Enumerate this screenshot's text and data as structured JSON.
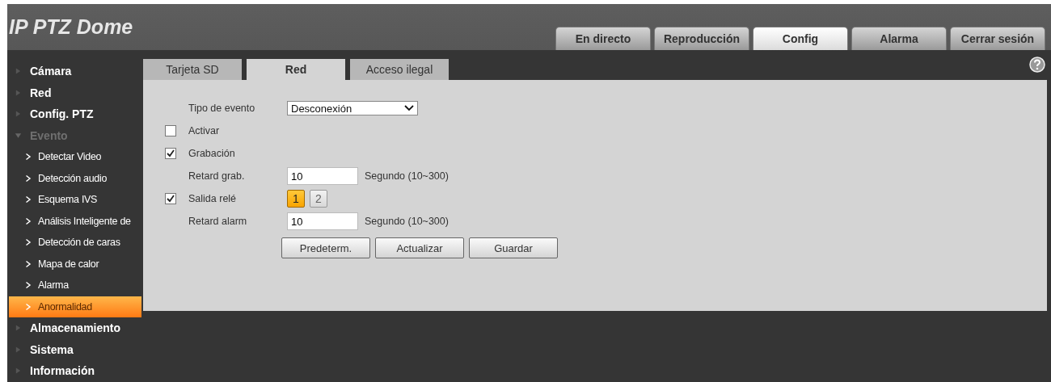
{
  "header": {
    "title": "IP PTZ Dome"
  },
  "nav_tabs": [
    {
      "label": "En directo",
      "selected": false
    },
    {
      "label": "Reproducción",
      "selected": false
    },
    {
      "label": "Config",
      "selected": true
    },
    {
      "label": "Alarma",
      "selected": false
    },
    {
      "label": "Cerrar sesión",
      "selected": false
    }
  ],
  "sidebar": {
    "items": [
      {
        "label": "Cámara",
        "expanded": false
      },
      {
        "label": "Red",
        "expanded": false
      },
      {
        "label": "Config. PTZ",
        "expanded": false
      },
      {
        "label": "Evento",
        "expanded": true,
        "children": [
          {
            "label": "Detectar Video",
            "selected": false
          },
          {
            "label": "Detección audio",
            "selected": false
          },
          {
            "label": "Esquema IVS",
            "selected": false
          },
          {
            "label": "Análisis Inteligente de",
            "selected": false
          },
          {
            "label": "Detección de caras",
            "selected": false
          },
          {
            "label": "Mapa de calor",
            "selected": false
          },
          {
            "label": "Alarma",
            "selected": false
          },
          {
            "label": "Anormalidad",
            "selected": true
          }
        ]
      },
      {
        "label": "Almacenamiento",
        "expanded": false
      },
      {
        "label": "Sistema",
        "expanded": false
      },
      {
        "label": "Información",
        "expanded": false
      }
    ]
  },
  "sub_tabs": [
    {
      "label": "Tarjeta SD",
      "selected": false
    },
    {
      "label": "Red",
      "selected": true
    },
    {
      "label": "Acceso ilegal",
      "selected": false
    }
  ],
  "form": [
    {
      "kind": "select",
      "label": "Tipo de evento",
      "value": "Desconexión"
    },
    {
      "kind": "checkbox",
      "label": "Activar",
      "checked": false
    },
    {
      "kind": "checkbox",
      "label": "Grabación",
      "checked": true
    },
    {
      "kind": "number",
      "label": "Retard grab.",
      "value": "10",
      "hint": "Segundo (10~300)"
    },
    {
      "kind": "relay",
      "label": "Salida relé",
      "checked": true,
      "options": [
        {
          "label": "1",
          "selected": true
        },
        {
          "label": "2",
          "selected": false
        }
      ]
    },
    {
      "kind": "number",
      "label": "Retard alarm",
      "value": "10",
      "hint": "Segundo (10~300)"
    }
  ],
  "buttons": [
    "Predeterm.",
    "Actualizar",
    "Guardar"
  ]
}
